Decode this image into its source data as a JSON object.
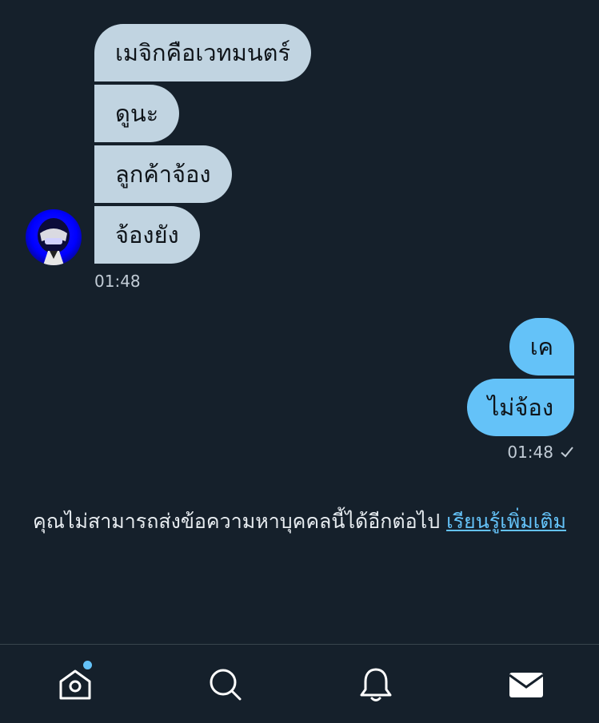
{
  "conversation": {
    "incoming_messages": [
      "เมจิกคือเวทมนตร์",
      "ดูนะ",
      "ลูกค้าจ้อง",
      "จ้องยัง"
    ],
    "incoming_time": "01:48",
    "outgoing_messages": [
      "เค",
      "ไม่จ้อง"
    ],
    "outgoing_time": "01:48",
    "outgoing_status_icon": "checkmark-icon"
  },
  "notice": {
    "text": "คุณไม่สามารถส่งข้อความหาบุคคลนี้ได้อีกต่อไป",
    "link_label": "เรียนรู้เพิ่มเติม"
  },
  "tabbar": {
    "items": [
      "home-icon",
      "search-icon",
      "notifications-icon",
      "messages-icon"
    ],
    "home_has_notification_dot": true
  },
  "colors": {
    "background": "#15202b",
    "incoming_bubble": "#c1d4e1",
    "outgoing_bubble": "#64c2f8",
    "accent": "#64c2f8"
  }
}
